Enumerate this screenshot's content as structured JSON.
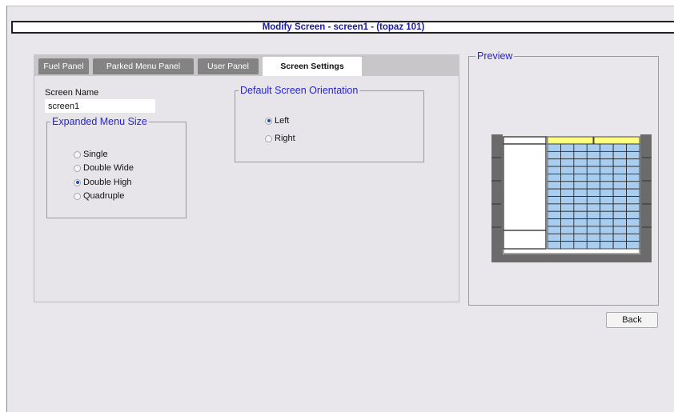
{
  "window": {
    "title": "Modify Screen - screen1 - (topaz 101)"
  },
  "tabs": [
    {
      "label": "Fuel Panel",
      "active": false
    },
    {
      "label": "Parked Menu Panel",
      "active": false
    },
    {
      "label": "User Panel",
      "active": false
    },
    {
      "label": "Screen Settings",
      "active": true
    }
  ],
  "screen_settings": {
    "screen_name_label": "Screen Name",
    "screen_name_value": "screen1",
    "expanded_menu": {
      "legend": "Expanded Menu Size",
      "options": [
        {
          "label": "Single",
          "selected": false
        },
        {
          "label": "Double Wide",
          "selected": false
        },
        {
          "label": "Double High",
          "selected": true
        },
        {
          "label": "Quadruple",
          "selected": false
        }
      ]
    },
    "orientation": {
      "legend": "Default Screen Orientation",
      "options": [
        {
          "label": "Left",
          "selected": true
        },
        {
          "label": "Right",
          "selected": false
        }
      ]
    }
  },
  "preview": {
    "legend": "Preview",
    "grid": {
      "rows": 14,
      "cols": 7,
      "header_cells": 2
    }
  },
  "buttons": {
    "back_label": "Back"
  },
  "colors": {
    "title_text": "#1a1aa8",
    "legend_text": "#2323d8",
    "tab_inactive": "#838383",
    "preview_button_fill": "#a9cdee",
    "preview_header_fill": "#ffff80",
    "preview_bezel": "#6b6b6b"
  }
}
